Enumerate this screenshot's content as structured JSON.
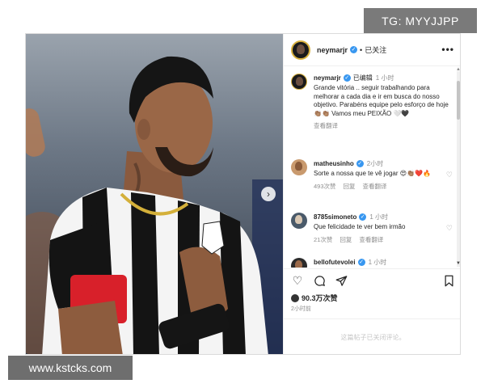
{
  "watermarks": {
    "top_right": "TG: MYYJJPP",
    "bottom_left": "www.kstcks.com"
  },
  "colors": {
    "accent_verified": "#3897f0",
    "text": "#262626",
    "muted": "#8e8e8e",
    "heart_red": "#e0245e"
  },
  "header": {
    "username": "neymarjr",
    "separator": "•",
    "follow_label": "已关注",
    "more_label": "•••"
  },
  "caption": {
    "username": "neymarjr",
    "edited_tag": "已编辑",
    "time": "1 小时",
    "text": "Grande vitória .. seguir trabalhando para melhorar a cada dia e ir em busca do nosso objetivo. Parabéns equipe pelo esforço de hoje 👏🏽👏🏽 Vamos meu PEIXÃO 🤍🖤",
    "see_translation": "查看翻译"
  },
  "comments": [
    {
      "username": "matheusinho",
      "time": "2小时",
      "text": "Sorte a nossa que te vê jogar 😍👏🏽❤️🔥",
      "likes": "493次赞",
      "reply": "回复",
      "see_translation": "查看翻译"
    },
    {
      "username": "8785simoneto",
      "time": "1 小时",
      "text": "Que felicidade te ver bem irmão",
      "likes": "21次赞",
      "reply": "回复",
      "see_translation": "查看翻译"
    },
    {
      "username": "bellofutevolei",
      "time": "1 小时",
      "text": "",
      "likes": "",
      "reply": "",
      "see_translation": ""
    }
  ],
  "actions": {
    "like_icon": "heart-icon",
    "comment_icon": "comment-icon",
    "share_icon": "share-icon",
    "save_icon": "bookmark-icon"
  },
  "stats": {
    "likes": "90.3万次赞",
    "posted": "2小时前"
  },
  "footer": {
    "comments_disabled": "这篇帖子已关闭评论。"
  }
}
